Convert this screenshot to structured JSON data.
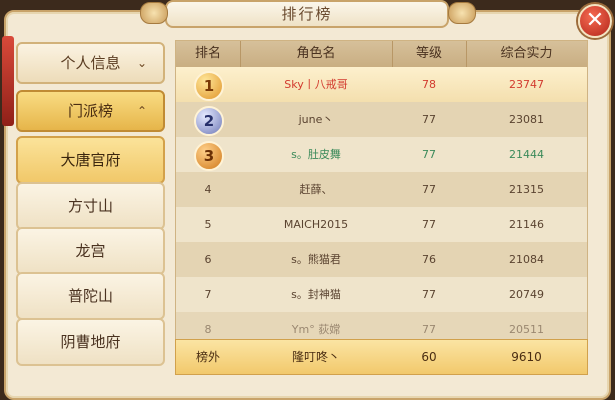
{
  "window": {
    "title": "排行榜",
    "close_icon": "✕"
  },
  "sidebar": {
    "personal_info": {
      "label": "个人信息",
      "chevron": "⌄"
    },
    "faction_rank": {
      "label": "门派榜",
      "chevron": "⌃"
    },
    "factions": [
      {
        "label": "大唐官府",
        "selected": true
      },
      {
        "label": "方寸山",
        "selected": false
      },
      {
        "label": "龙宫",
        "selected": false
      },
      {
        "label": "普陀山",
        "selected": false
      },
      {
        "label": "阴曹地府",
        "selected": false
      }
    ]
  },
  "table": {
    "columns": [
      "排名",
      "角色名",
      "等级",
      "综合实力"
    ],
    "rows": [
      {
        "rank": "1",
        "name": "Sky丨八戒哥",
        "level": "78",
        "power": "23747",
        "color": "red"
      },
      {
        "rank": "2",
        "name": "june丶",
        "level": "77",
        "power": "23081",
        "color": "normal"
      },
      {
        "rank": "3",
        "name": "s。肚皮舞",
        "level": "77",
        "power": "21444",
        "color": "green"
      },
      {
        "rank": "4",
        "name": "赶薛、",
        "level": "77",
        "power": "21315",
        "color": "normal"
      },
      {
        "rank": "5",
        "name": "MAICH2015",
        "level": "77",
        "power": "21146",
        "color": "normal"
      },
      {
        "rank": "6",
        "name": "s。熊猫君",
        "level": "76",
        "power": "21084",
        "color": "normal"
      },
      {
        "rank": "7",
        "name": "s。封神猫",
        "level": "77",
        "power": "20749",
        "color": "normal"
      },
      {
        "rank": "8",
        "name": "Ym°  荻嫦",
        "level": "77",
        "power": "20511",
        "color": "normal"
      }
    ],
    "self": {
      "rank": "榜外",
      "name": "隆叮咚丶",
      "level": "60",
      "power": "9610"
    }
  }
}
